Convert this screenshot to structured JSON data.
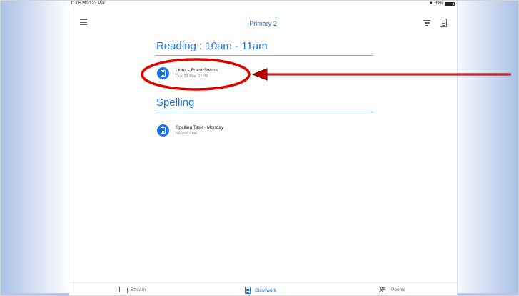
{
  "status_bar": {
    "time": "11:05  Mon 23 Mar",
    "battery": "89%",
    "battery_level": 0.89
  },
  "app_bar": {
    "class_name": "Primary 2",
    "menu_icon": "hamburger-menu-icon",
    "filter_icon": "filter-icon",
    "folder_icon": "class-drive-folder-icon"
  },
  "topics": [
    {
      "title": "Reading : 10am - 11am",
      "items": [
        {
          "title": "Lions - Frank Swims",
          "subtitle": "Due 23 Mar, 15:00",
          "icon": "assignment-icon"
        }
      ]
    },
    {
      "title": "Spelling",
      "items": [
        {
          "title": "Spelling Task - Monday",
          "subtitle": "No due date",
          "icon": "assignment-icon"
        }
      ]
    }
  ],
  "bottom_nav": {
    "stream": "Stream",
    "classwork": "Classwork",
    "people": "People",
    "active": "classwork"
  },
  "colors": {
    "accent": "#1a73e8",
    "annotation": "#e00000",
    "arrow": "#8b0000"
  }
}
